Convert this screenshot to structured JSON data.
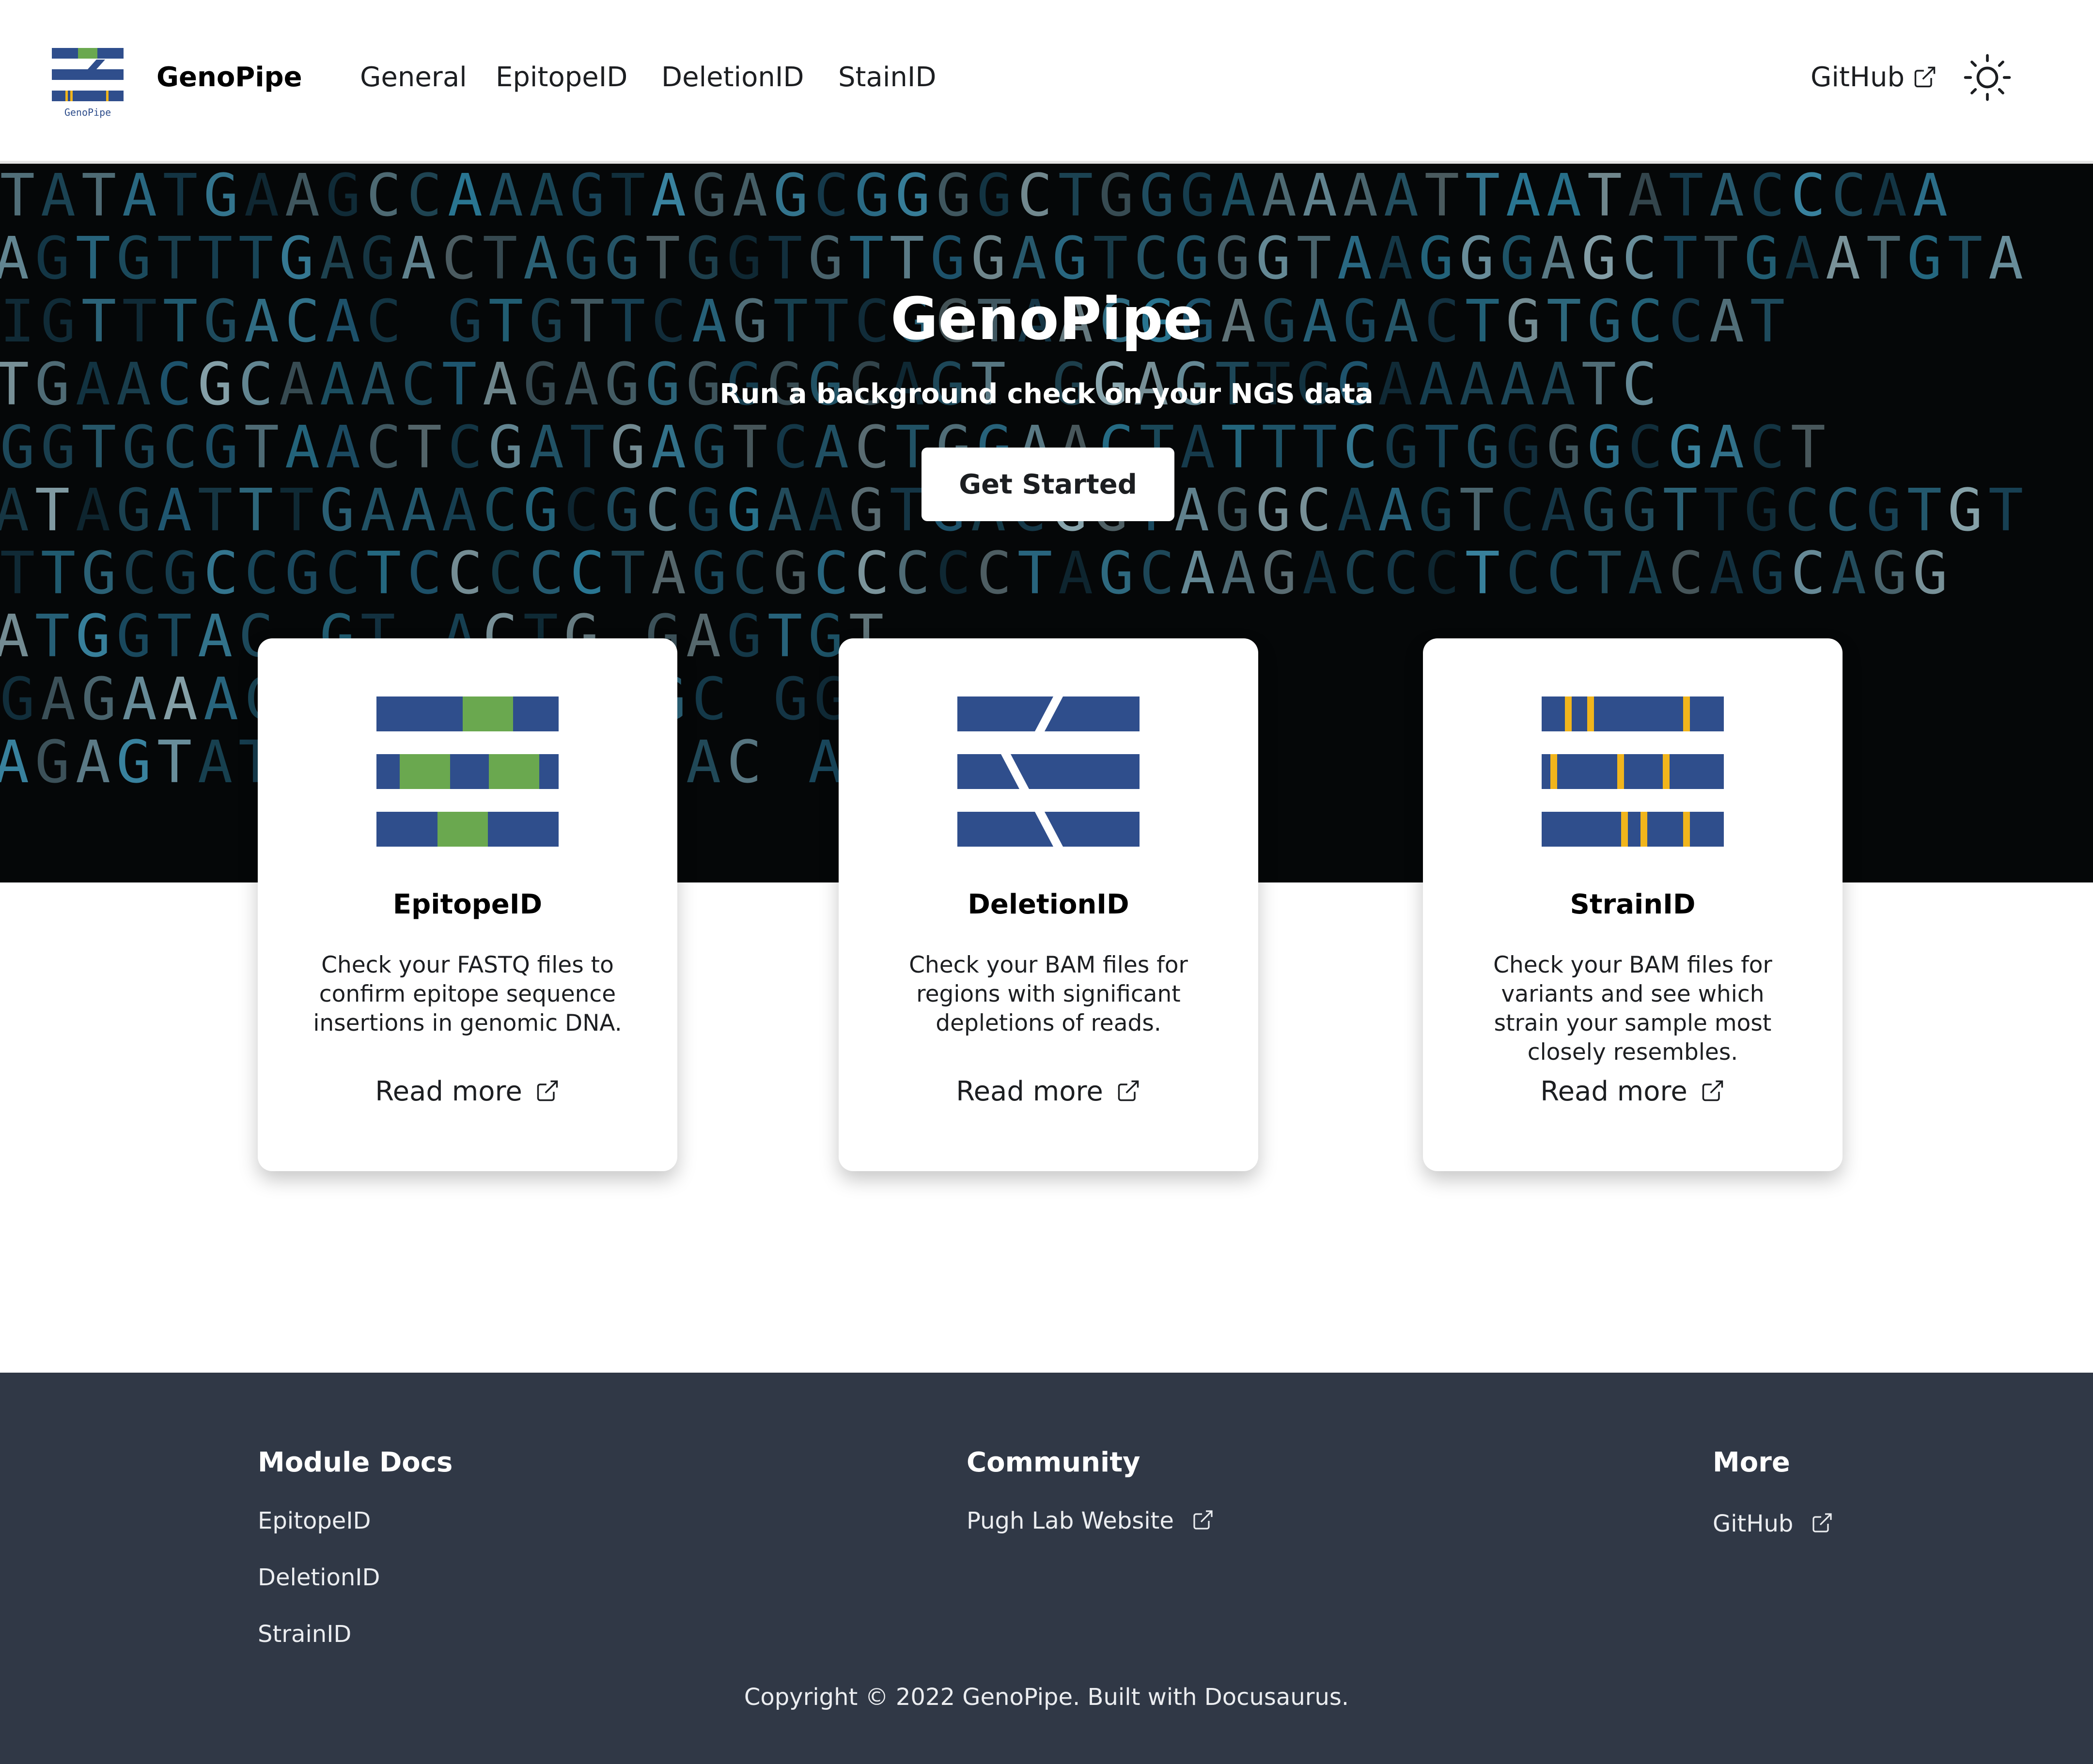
{
  "navbar": {
    "logo_text": "GenoPipe",
    "brand": "GenoPipe",
    "links": [
      "General",
      "EpitopeID",
      "DeletionID",
      "StainID"
    ],
    "github": "GitHub",
    "theme_toggle_icon": "sun-icon"
  },
  "hero": {
    "title": "GenoPipe",
    "subtitle": "Run a background check on your NGS data",
    "cta": "Get Started",
    "background_rows": [
      "TATATGAAGCCAAAGTAGAGCGGGGCTGGGAAAAATTAATATACCCAA",
      "AGTGTTTGAGACTAGGTGGTGTTGGAGTCGGGTAAGGGAGCTTGAATGTA",
      "IGTTTGACAC GTGTTCAGTTCGGTAACGGAGAGACTGTGCCAT",
      "TGAACGCAAACTAGAGGGGGGCAGT GGAGTTGGAAAAATC",
      "GGTGCGTAACTCGATGAGTCACTGGAACTATTTCGTGGGGCGACT",
      "ATAGATTTGAAACGCGCGGAAGTGACGGTAGGCAAGTCAGGTTGCCGTGT",
      "TTGCGCCGCTCCCCCTAGCGCCCCCTAGCAAGACCCTCCTACAGCAGG",
      "ATGGTAC GT ACTG GAGTGT",
      "GAGAAAC GCGC GTCGC GGG",
      "AGAGTAT ACAAC CTCAC ATTAAG"
    ]
  },
  "cards": [
    {
      "title": "EpitopeID",
      "description": "Check your FASTQ files to confirm epitope sequence insertions in genomic DNA.",
      "link": "Read more",
      "icon": "epitope-icon"
    },
    {
      "title": "DeletionID",
      "description": "Check your BAM files for regions with significant depletions of reads.",
      "link": "Read more",
      "icon": "deletion-icon"
    },
    {
      "title": "StrainID",
      "description": "Check your BAM files for variants and see which strain your sample most closely resembles.",
      "link": "Read more",
      "icon": "strain-icon"
    }
  ],
  "footer": {
    "columns": [
      {
        "heading": "Module Docs",
        "links": [
          "EpitopeID",
          "DeletionID",
          "StrainID"
        ]
      },
      {
        "heading": "Community",
        "links": [
          "Pugh Lab Website"
        ]
      },
      {
        "heading": "More",
        "links": [
          "GitHub"
        ]
      }
    ],
    "copyright": "Copyright © 2022 GenoPipe. Built with Docusaurus."
  },
  "colors": {
    "brand_blue": "#2f4e8c",
    "epitope_green": "#6aa84f",
    "strain_gold": "#f1b51c",
    "hero_bg": "#050708",
    "footer_bg": "#303846"
  }
}
